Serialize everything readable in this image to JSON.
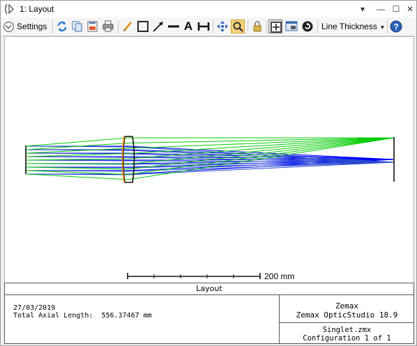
{
  "window": {
    "title": "1: Layout",
    "controls": [
      "▾",
      "—",
      "☐",
      "✕"
    ]
  },
  "toolbar": {
    "settings_label": "Settings",
    "line_thickness_label": "Line Thickness",
    "line_thickness_arrow": "▾",
    "help_glyph": "?",
    "text_tool_glyph": "A"
  },
  "plot": {
    "scale_bar_label": "200 mm",
    "ray_colors": {
      "field1": "#0000ff",
      "field2": "#2a4ad0",
      "field3": "#00cc00"
    },
    "lens_edge_color": "#ff8000"
  },
  "footer": {
    "title": "Layout",
    "date": "27/03/2019",
    "total_axial_length_label": "Total Axial Length:",
    "total_axial_length_value": "556.37467 mm",
    "company": "Zemax",
    "product": "Zemax OpticStudio 18.9",
    "file": "Singlet.zmx",
    "configuration": "Configuration 1 of 1"
  }
}
